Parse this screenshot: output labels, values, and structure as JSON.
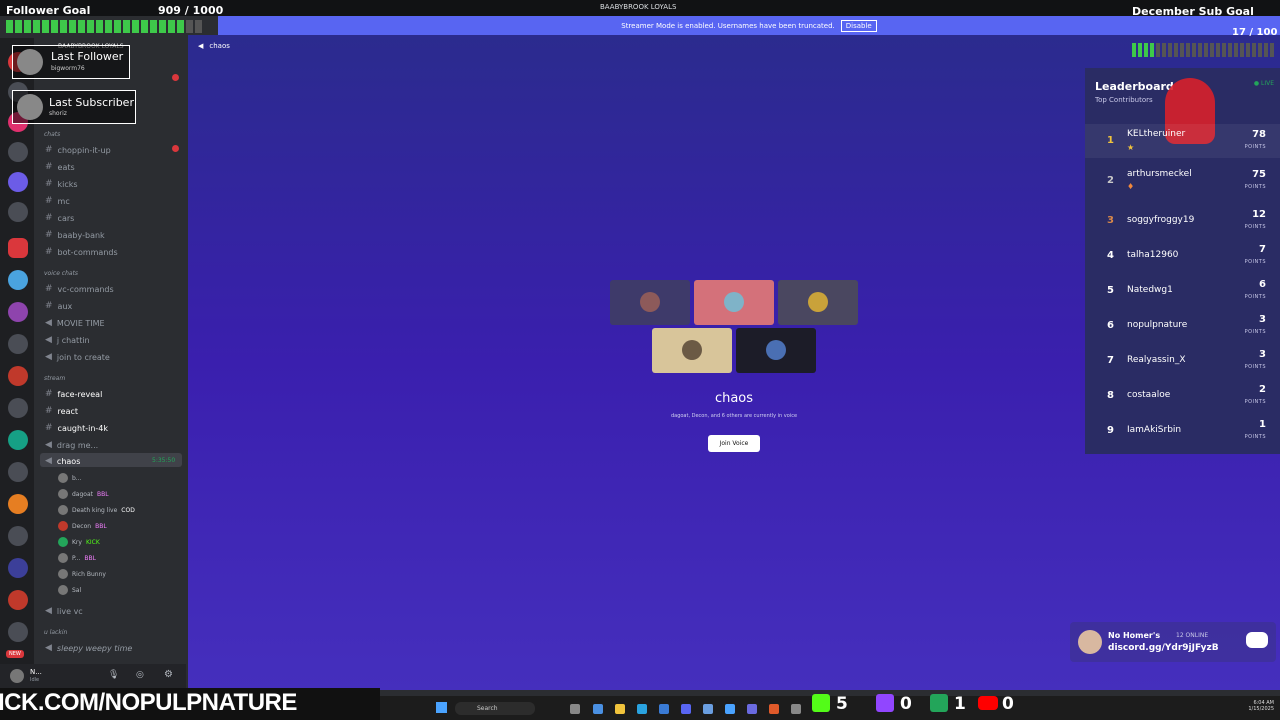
{
  "window": {
    "title": "BAABYBROOK LOYALS"
  },
  "streamer_mode": {
    "text": "Streamer Mode is enabled. Usernames have been truncated.",
    "button": "Disable"
  },
  "overlay": {
    "follower_goal": {
      "title": "Follower Goal",
      "count": "909 / 1000",
      "progress": 0.909
    },
    "sub_goal": {
      "title": "December Sub Goal",
      "count": "17 / 100",
      "progress": 0.17
    },
    "last_follower": {
      "title": "Last Follower",
      "name": "bigworm76"
    },
    "last_subscriber": {
      "title": "Last Subscriber",
      "name": "shoriz"
    },
    "bottom_banner": "ICK.COM/NOPULPNATURE",
    "discord_card": {
      "title": "No Homer's",
      "online": "12 ONLINE",
      "link": "discord.gg/Ydr9jJFyzB"
    }
  },
  "server": {
    "name": "BAABYBROOK LOYALS"
  },
  "channels": {
    "cat_chats": "chats",
    "text": [
      {
        "label": "choppin-it-up"
      },
      {
        "label": "eats"
      },
      {
        "label": "kicks"
      },
      {
        "label": "mc"
      },
      {
        "label": "cars"
      },
      {
        "label": "baaby-bank"
      },
      {
        "label": "bot-commands"
      }
    ],
    "cat_voice": "voice chats",
    "voice": [
      {
        "label": "vc-commands"
      },
      {
        "label": "aux"
      },
      {
        "label": "MOVIE TIME"
      },
      {
        "label": "j chattin"
      },
      {
        "label": "join to create"
      }
    ],
    "cat_stream": "stream",
    "stream": [
      {
        "label": "face-reveal"
      },
      {
        "label": "react"
      },
      {
        "label": "caught-in-4k"
      },
      {
        "label": "drag me..."
      }
    ],
    "chaos": {
      "label": "chaos",
      "time": "5:35:50"
    },
    "voice_users": [
      {
        "name": "b..."
      },
      {
        "name": "dagoat",
        "tag": "BBL"
      },
      {
        "name": "Death king live",
        "tag": "COD"
      },
      {
        "name": "Decon",
        "tag": "BBL"
      },
      {
        "name": "Kry",
        "tag": "KICK"
      },
      {
        "name": "P...",
        "tag": "BBL"
      },
      {
        "name": "Rich Bunny"
      },
      {
        "name": "Sal"
      }
    ],
    "live_vc": "live vc",
    "cat_ulackin": "u lackin",
    "sleepy": "sleepy weepy time"
  },
  "user_panel": {
    "name": "N...",
    "status": "Idle"
  },
  "main": {
    "channel_title": "chaos",
    "voice_title": "chaos",
    "voice_sub": "dagoat, Decon, and 6 others are currently in voice",
    "join_button": "Join Voice"
  },
  "leaderboard": {
    "title": "Leaderboard",
    "subtitle": "Top Contributors",
    "live": "LIVE",
    "points_label": "POINTS",
    "rows": [
      {
        "rank": "1",
        "name": "KELtheruiner",
        "points": "78"
      },
      {
        "rank": "2",
        "name": "arthursmeckel",
        "points": "75"
      },
      {
        "rank": "3",
        "name": "soggyfroggy19",
        "points": "12"
      },
      {
        "rank": "4",
        "name": "talha12960",
        "points": "7"
      },
      {
        "rank": "5",
        "name": "Natedwg1",
        "points": "6"
      },
      {
        "rank": "6",
        "name": "nopulpnature",
        "points": "3"
      },
      {
        "rank": "7",
        "name": "Realyassin_X",
        "points": "3"
      },
      {
        "rank": "8",
        "name": "costaaloe",
        "points": "2"
      },
      {
        "rank": "9",
        "name": "IamAkiSrbin",
        "points": "1"
      }
    ]
  },
  "taskbar": {
    "search": "Search",
    "time": "6:04 AM",
    "date": "1/15/2025",
    "counters": {
      "kick": "5",
      "twitch": "0",
      "green": "1",
      "youtube": "0"
    }
  },
  "colors": {
    "accent": "#5865f2",
    "gold": "#f0c33c",
    "green_bar": "#3ec94a",
    "live": "#23a55a"
  }
}
